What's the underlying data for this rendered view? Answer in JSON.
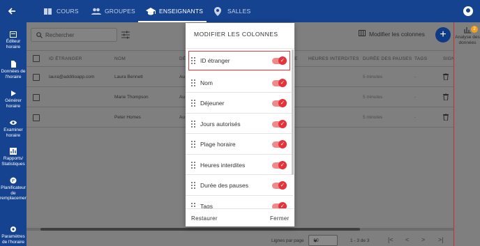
{
  "topbar": {
    "tabs": [
      {
        "label": "COURS",
        "icon": "book-icon"
      },
      {
        "label": "GROUPES",
        "icon": "group-icon"
      },
      {
        "label": "ENSEIGNANTS",
        "icon": "school-icon"
      },
      {
        "label": "SALLES",
        "icon": "location-icon"
      }
    ],
    "active_tab": "ENSEIGNANTS"
  },
  "sidebar": {
    "items": [
      {
        "label": "Éditeur horaire",
        "icon": "calendar-edit-icon"
      },
      {
        "label": "Données de l'horaire",
        "icon": "document-icon"
      },
      {
        "label": "Générer horaire",
        "icon": "play-icon"
      },
      {
        "label": "Examiner horaire",
        "icon": "eye-icon"
      },
      {
        "label": "Rapports/ Statistiques",
        "icon": "chart-icon"
      },
      {
        "label": "Planificateur de remplacement",
        "icon": "swap-icon"
      },
      {
        "label": "Paramètres de l'horaire",
        "icon": "gear-icon"
      }
    ]
  },
  "toolbar": {
    "search_placeholder": "Rechercher",
    "modify_columns_label": "Modifier les colonnes",
    "add_label": "+"
  },
  "table": {
    "headers": [
      "ID ÉTRANGER",
      "NOM",
      "DÉ",
      "HEURES INTERDITES",
      "DURÉE DES PAUSES",
      "TAGS",
      "SIGN"
    ],
    "rows": [
      {
        "id": "laura@additioapp.com",
        "name": "Laura Bennett",
        "dej": "Au",
        "pauses": "5 minutes",
        "tags": "-"
      },
      {
        "id": "",
        "name": "Marie Thompson",
        "dej": "Au",
        "pauses": "5 minutes",
        "tags": "-"
      },
      {
        "id": "",
        "name": "Peter Homes",
        "dej": "Au",
        "pauses": "5 minutes",
        "tags": "-"
      }
    ],
    "extra_header": "IE"
  },
  "pagination": {
    "rows_per_page_label": "Lignes par page",
    "rows_per_page_value": "10",
    "range": "1 - 3 de 3"
  },
  "right_panel": {
    "label": "Analyse des données",
    "badge": "2"
  },
  "modal": {
    "title": "MODIFIER LES COLONNES",
    "columns": [
      {
        "label": "ID étranger",
        "enabled": true
      },
      {
        "label": "Nom",
        "enabled": true
      },
      {
        "label": "Déjeuner",
        "enabled": true
      },
      {
        "label": "Jours autorisés",
        "enabled": true
      },
      {
        "label": "Plage horaire",
        "enabled": true
      },
      {
        "label": "Heures interdites",
        "enabled": true
      },
      {
        "label": "Durée des pauses",
        "enabled": true
      },
      {
        "label": "Tags",
        "enabled": true
      }
    ],
    "restore_label": "Restaurer",
    "close_label": "Fermer"
  },
  "colors": {
    "brand": "#15438f",
    "toggle_on": "#e8313a",
    "highlight": "#e04040"
  }
}
